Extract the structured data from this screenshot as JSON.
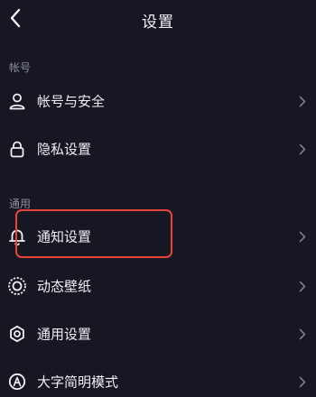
{
  "header": {
    "title": "设置",
    "back_icon": "chevron-left-icon"
  },
  "sections": {
    "account": {
      "title": "帐号",
      "items": [
        {
          "label": "帐号与安全",
          "icon": "person-icon"
        },
        {
          "label": "隐私设置",
          "icon": "lock-icon"
        }
      ]
    },
    "general": {
      "title": "通用",
      "items": [
        {
          "label": "通知设置",
          "icon": "bell-icon"
        },
        {
          "label": "动态壁纸",
          "icon": "dynamic-wallpaper-icon"
        },
        {
          "label": "通用设置",
          "icon": "gear-icon"
        },
        {
          "label": "大字简明模式",
          "icon": "large-font-icon"
        }
      ]
    }
  },
  "colors": {
    "background": "#161722",
    "text": "#f0f0f2",
    "section_title": "#8d8e99",
    "chevron": "#7b7c87",
    "highlight": "#e6463a"
  }
}
